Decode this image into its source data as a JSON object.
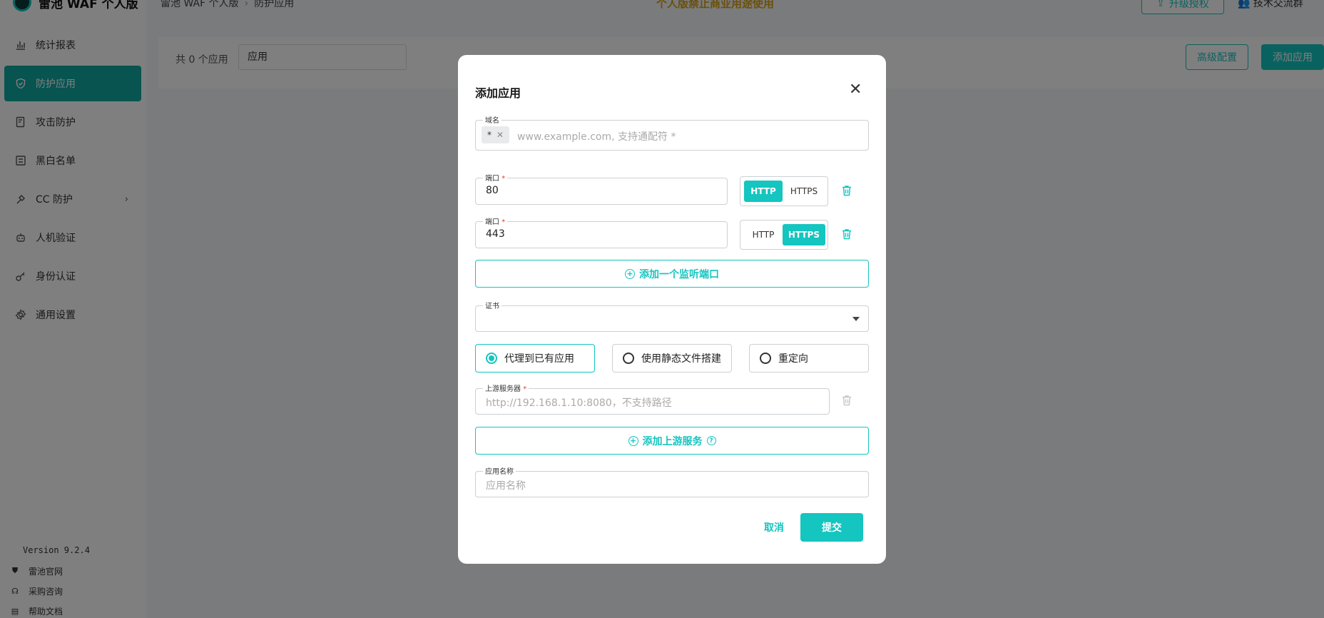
{
  "app": {
    "logo_text": "雷池 WAF 个人版"
  },
  "breadcrumb": {
    "root": "雷池 WAF 个人版",
    "current": "防护应用"
  },
  "header": {
    "notice": "个人版禁止商业用途使用",
    "upgrade_label": "升级授权",
    "group_label": "技术交流群"
  },
  "sidebar": {
    "items": [
      {
        "label": "统计报表",
        "icon": "bar-chart-icon"
      },
      {
        "label": "防护应用",
        "icon": "shield-icon",
        "active": true
      },
      {
        "label": "攻击防护",
        "icon": "document-shield-icon"
      },
      {
        "label": "黑白名单",
        "icon": "list-icon"
      },
      {
        "label": "CC 防护",
        "icon": "tool-icon",
        "has_submenu": true
      },
      {
        "label": "人机验证",
        "icon": "robot-icon"
      },
      {
        "label": "身份认证",
        "icon": "key-icon"
      },
      {
        "label": "通用设置",
        "icon": "gear-icon"
      }
    ],
    "version": "Version 9.2.4",
    "footer_links": [
      {
        "label": "雷池官网",
        "icon": "shield-small-icon"
      },
      {
        "label": "采购咨询",
        "icon": "headset-icon"
      },
      {
        "label": "帮助文档",
        "icon": "doc-icon"
      }
    ]
  },
  "toolbar": {
    "count_text": "共 0 个应用",
    "search_value": "应用",
    "advanced_label": "高级配置",
    "add_label": "添加应用"
  },
  "modal": {
    "title": "添加应用",
    "domain": {
      "label": "域名",
      "chip": "*",
      "placeholder": "www.example.com, 支持通配符 *"
    },
    "ports": [
      {
        "label": "端口",
        "value": "80",
        "http": "HTTP",
        "https": "HTTPS",
        "selected": "HTTP"
      },
      {
        "label": "端口",
        "value": "443",
        "http": "HTTP",
        "https": "HTTPS",
        "selected": "HTTPS"
      }
    ],
    "add_port_label": "添加一个监听端口",
    "cert": {
      "label": "证书",
      "value": ""
    },
    "modes": [
      {
        "label": "代理到已有应用",
        "selected": true
      },
      {
        "label": "使用静态文件搭建",
        "selected": false
      },
      {
        "label": "重定向",
        "selected": false
      }
    ],
    "upstream": {
      "label": "上游服务器",
      "placeholder": "http://192.168.1.10:8080，不支持路径"
    },
    "add_upstream_label": "添加上游服务",
    "app_name": {
      "label": "应用名称",
      "placeholder": "应用名称"
    },
    "cancel_label": "取消",
    "submit_label": "提交"
  },
  "colors": {
    "accent": "#14c5c0",
    "notice": "#d4a017",
    "required": "#e53935"
  }
}
